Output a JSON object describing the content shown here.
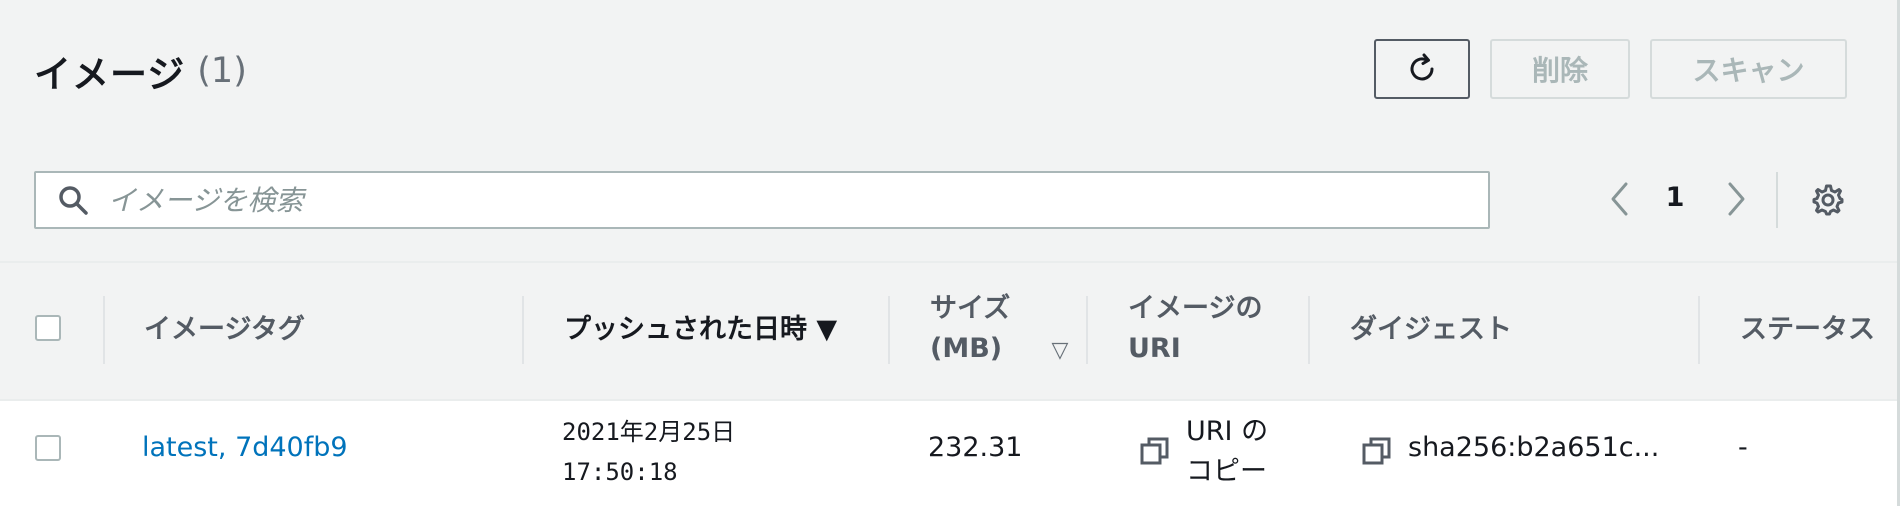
{
  "header": {
    "title": "イメージ",
    "count": "(1)"
  },
  "actions": {
    "refresh_icon": "refresh-icon",
    "delete_label": "削除",
    "scan_label": "スキャン"
  },
  "search": {
    "placeholder": "イメージを検索",
    "value": "",
    "icon": "search-icon"
  },
  "pagination": {
    "current_page": "1",
    "prev_icon": "chevron-left-icon",
    "next_icon": "chevron-right-icon",
    "settings_icon": "gear-icon"
  },
  "table": {
    "columns": [
      {
        "label": "イメージタグ"
      },
      {
        "label": "プッシュされた日時 ▼",
        "sorted": "descending"
      },
      {
        "label_line1": "サイズ",
        "label_line2": "(MB)",
        "sort_icon": "▽"
      },
      {
        "label_line1": "イメージの",
        "label_line2": "URI"
      },
      {
        "label": "ダイジェスト"
      },
      {
        "label": "ステータス"
      }
    ],
    "rows": [
      {
        "tag": "latest, 7d40fb9",
        "pushed_date": "2021年2月25日",
        "pushed_time": "17:50:18",
        "size_mb": "232.31",
        "uri_copy_line1": "URI の",
        "uri_copy_line2": "コピー",
        "digest": "sha256:b2a651c...",
        "status": "-"
      }
    ]
  },
  "colors": {
    "background": "#f2f3f3",
    "link": "#0073bb",
    "text": "#16191f",
    "muted": "#687078",
    "disabled": "#aab7b8"
  }
}
